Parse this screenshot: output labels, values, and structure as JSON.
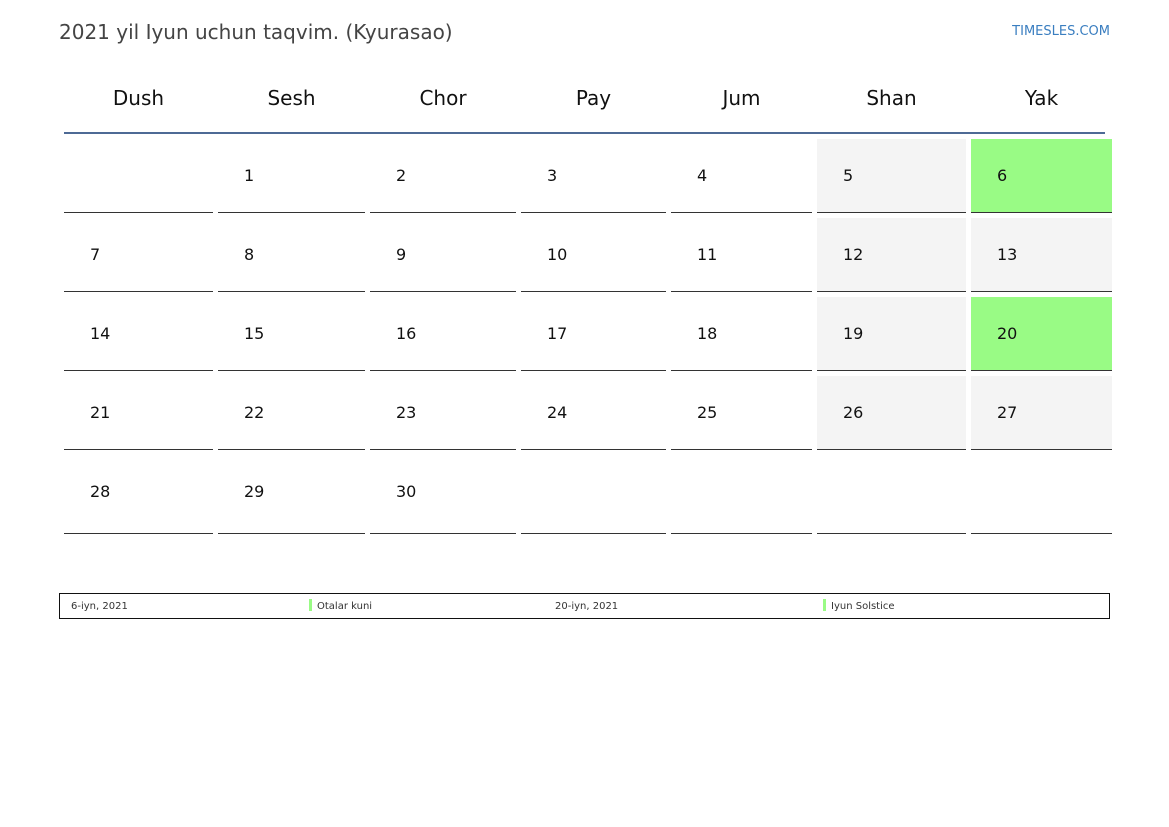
{
  "header": {
    "title": "2021 yil Iyun uchun taqvim. (Kyurasao)",
    "site_link": "TIMESLES.COM"
  },
  "calendar": {
    "weekdays": [
      "Dush",
      "Sesh",
      "Chor",
      "Pay",
      "Jum",
      "Shan",
      "Yak"
    ],
    "weeks": [
      [
        "",
        "1",
        "2",
        "3",
        "4",
        "5",
        "6"
      ],
      [
        "7",
        "8",
        "9",
        "10",
        "11",
        "12",
        "13"
      ],
      [
        "14",
        "15",
        "16",
        "17",
        "18",
        "19",
        "20"
      ],
      [
        "21",
        "22",
        "23",
        "24",
        "25",
        "26",
        "27"
      ],
      [
        "28",
        "29",
        "30",
        "",
        "",
        "",
        ""
      ]
    ],
    "holidays": [
      "6",
      "20"
    ]
  },
  "legend": {
    "items": [
      {
        "date": "6-iyn, 2021",
        "name": "Otalar kuni"
      },
      {
        "date": "20-iyn, 2021",
        "name": "Iyun Solstice"
      }
    ]
  },
  "colors": {
    "holiday": "#99fb85",
    "weekend": "#f4f4f4",
    "header_rule": "#4e6a95",
    "link": "#3a7ec0"
  }
}
